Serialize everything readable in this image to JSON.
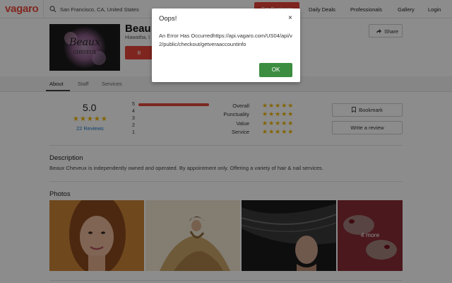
{
  "nav": {
    "logo": "vagaro",
    "location": "San Francisco, CA, United States",
    "for_business": "For Business",
    "links": [
      "Daily Deals",
      "Professionals",
      "Gallery",
      "Login"
    ]
  },
  "business": {
    "name": "Beau",
    "subtitle": "Hiawatha, I",
    "book_label": "B",
    "logo_script_line1": "Beaux",
    "logo_script_line2": "CHEVEUX",
    "share_label": "Share"
  },
  "tabs": [
    "About",
    "Staff",
    "Services"
  ],
  "rating": {
    "score": "5.0",
    "stars": "★★★★★",
    "review_count": "22 Reviews",
    "distribution": [
      {
        "star": "5",
        "fraction": 1.0
      },
      {
        "star": "4",
        "fraction": 0
      },
      {
        "star": "3",
        "fraction": 0
      },
      {
        "star": "2",
        "fraction": 0
      },
      {
        "star": "1",
        "fraction": 0
      }
    ],
    "categories": [
      {
        "label": "Overall",
        "stars": "★★★★★"
      },
      {
        "label": "Punctuality",
        "stars": "★★★★★"
      },
      {
        "label": "Value",
        "stars": "★★★★★"
      },
      {
        "label": "Service",
        "stars": "★★★★★"
      }
    ],
    "bookmark_label": "Bookmark",
    "write_review_label": "Write a review"
  },
  "description": {
    "title": "Description",
    "text": "Beaux Cheveux is independently owned and operated. By appointment only. Offering a variety of hair & nail services."
  },
  "photos": {
    "title": "Photos",
    "more_label": "4 more"
  },
  "modal": {
    "title": "Oops!",
    "close": "×",
    "message": "An Error Has Occurredhttps://api.vagaro.com/US04/api/v2/public/checkout/getveraaccountinfo",
    "ok_label": "OK"
  },
  "colors": {
    "brand": "#ec4b3c",
    "star": "#f0b400",
    "link": "#1b77c5",
    "ok_button": "#3c8d40"
  }
}
